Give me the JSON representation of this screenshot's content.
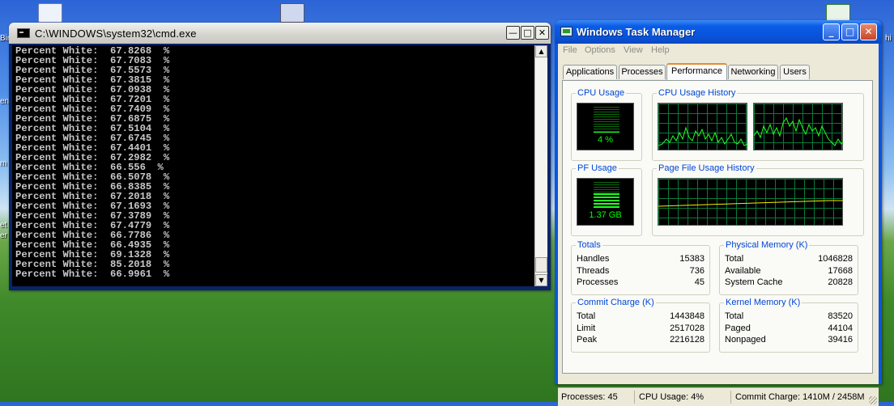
{
  "cmd": {
    "title": "C:\\WINDOWS\\system32\\cmd.exe",
    "lines": [
      "Percent White:  67.8268  %",
      "Percent White:  67.7083  %",
      "Percent White:  67.5573  %",
      "Percent White:  67.3815  %",
      "Percent White:  67.0938  %",
      "Percent White:  67.7201  %",
      "Percent White:  67.7409  %",
      "Percent White:  67.6875  %",
      "Percent White:  67.5104  %",
      "Percent White:  67.6745  %",
      "Percent White:  67.4401  %",
      "Percent White:  67.2982  %",
      "Percent White:  66.556  %",
      "Percent White:  66.5078  %",
      "Percent White:  66.8385  %",
      "Percent White:  67.2018  %",
      "Percent White:  67.1693  %",
      "Percent White:  67.3789  %",
      "Percent White:  67.4779  %",
      "Percent White:  66.7786  %",
      "Percent White:  66.4935  %",
      "Percent White:  69.1328  %",
      "Percent White:  85.2018  %",
      "Percent White:  66.9961  %"
    ]
  },
  "taskmgr": {
    "title": "Windows Task Manager",
    "menu": [
      "File",
      "Options",
      "View",
      "Help"
    ],
    "tabs": [
      "Applications",
      "Processes",
      "Performance",
      "Networking",
      "Users"
    ],
    "active_tab": "Performance",
    "cpu_usage": {
      "label": "CPU Usage",
      "value": "4 %",
      "percent": 4
    },
    "cpu_history": {
      "label": "CPU Usage History"
    },
    "pf_usage": {
      "label": "PF Usage",
      "value": "1.37 GB",
      "fraction": 0.56
    },
    "pf_history": {
      "label": "Page File Usage History"
    },
    "totals": {
      "label": "Totals",
      "rows": [
        {
          "k": "Handles",
          "v": "15383"
        },
        {
          "k": "Threads",
          "v": "736"
        },
        {
          "k": "Processes",
          "v": "45"
        }
      ]
    },
    "physical": {
      "label": "Physical Memory (K)",
      "rows": [
        {
          "k": "Total",
          "v": "1046828"
        },
        {
          "k": "Available",
          "v": "17668"
        },
        {
          "k": "System Cache",
          "v": "20828"
        }
      ]
    },
    "commit": {
      "label": "Commit Charge (K)",
      "rows": [
        {
          "k": "Total",
          "v": "1443848"
        },
        {
          "k": "Limit",
          "v": "2517028"
        },
        {
          "k": "Peak",
          "v": "2216128"
        }
      ]
    },
    "kernel": {
      "label": "Kernel Memory (K)",
      "rows": [
        {
          "k": "Total",
          "v": "83520"
        },
        {
          "k": "Paged",
          "v": "44104"
        },
        {
          "k": "Nonpaged",
          "v": "39416"
        }
      ]
    },
    "status": {
      "processes": "Processes: 45",
      "cpu": "CPU Usage: 4%",
      "commit": "Commit Charge: 1410M / 2458M"
    }
  },
  "desktop": {
    "fragments": [
      "Bin",
      "ent",
      "m",
      "et",
      "er",
      "hi"
    ]
  },
  "colors": {
    "xp_blue": "#0b55e0",
    "meter_green": "#00ff00",
    "group_label": "#0046d5"
  }
}
